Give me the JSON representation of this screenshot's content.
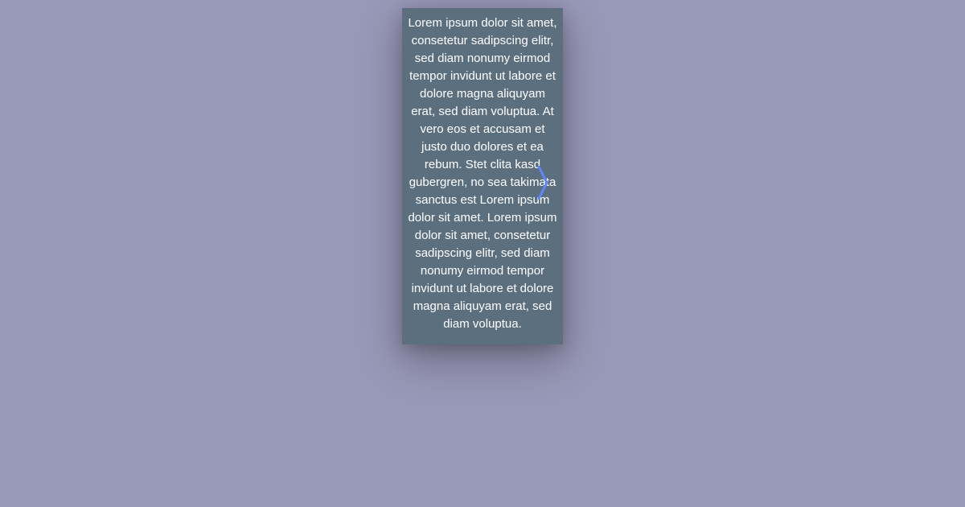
{
  "card": {
    "body": "Lorem ipsum dolor sit amet, consetetur sadipscing elitr, sed diam nonumy eirmod tempor invidunt ut labore et dolore magna aliquyam erat, sed diam voluptua. At vero eos et accusam et justo duo dolores et ea rebum. Stet clita kasd gubergren, no sea takimata sanctus est Lorem ipsum dolor sit amet. Lorem ipsum dolor sit amet, consetetur sadipscing elitr, sed diam nonumy eirmod tempor invidunt ut labore et dolore magna aliquyam erat, sed diam voluptua."
  }
}
